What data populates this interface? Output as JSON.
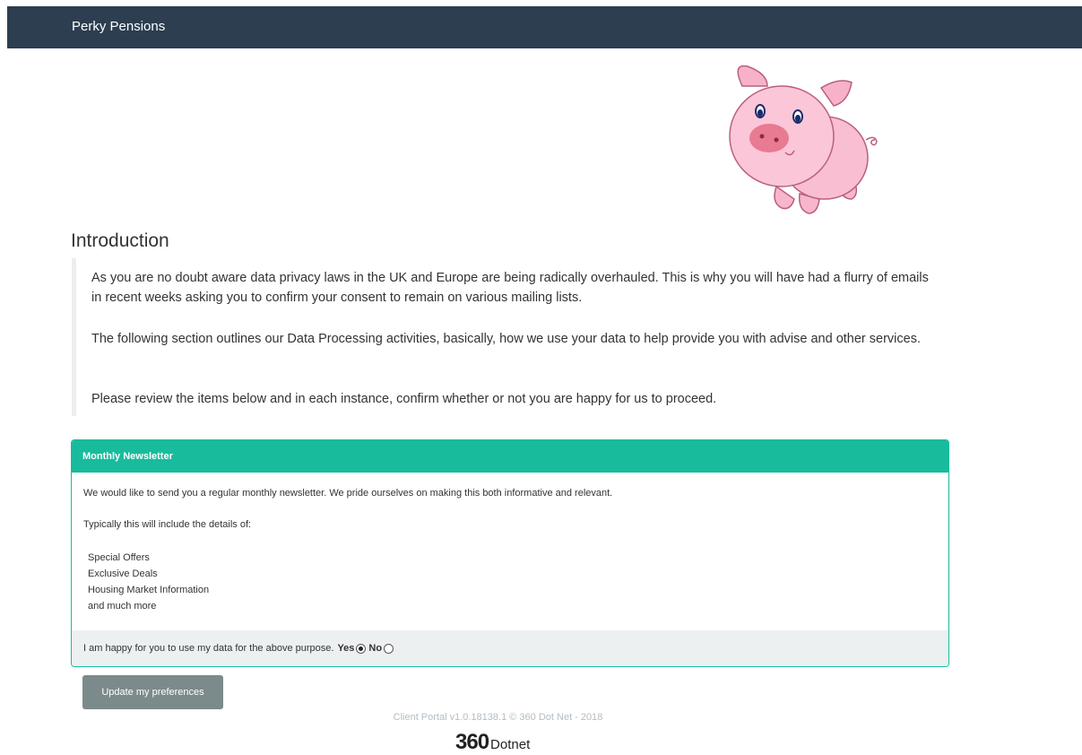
{
  "navbar": {
    "brand": "Perky Pensions"
  },
  "intro": {
    "title": "Introduction",
    "paragraphs": [
      "As you are no doubt aware data privacy laws in the UK and Europe are being radically overhauled. This is why you will have had a flurry of emails in recent weeks asking you to confirm your consent to remain on various mailing lists.",
      "The following section outlines our Data Processing activities, basically, how we use your data to help provide you with advise and other services.",
      "Please review the items below and in each instance, confirm whether or not you are happy for us to proceed."
    ]
  },
  "panel": {
    "heading": "Monthly Newsletter",
    "text1": "We would like to send you a regular monthly newsletter. We pride ourselves on making this both informative and relevant.",
    "text2": "Typically this will include the details of:",
    "items": [
      "Special Offers",
      "Exclusive Deals",
      "Housing Market Information",
      "and much more"
    ],
    "consent_text": "I am happy for you to use my data for the above purpose.",
    "yes_label": "Yes",
    "no_label": "No",
    "selected": "Yes"
  },
  "button": {
    "label": "Update my preferences"
  },
  "footer": {
    "text": "Client Portal v1.0.18138.1 © 360 Dot Net - 2018",
    "logo_num": "360",
    "logo_text": "Dotnet"
  },
  "colors": {
    "navbar": "#2c3e50",
    "panel_accent": "#18bc9c",
    "button": "#7b8a8b",
    "footer_bg": "#ecf0f1"
  },
  "images": {
    "mascot": "pig-mascot"
  }
}
